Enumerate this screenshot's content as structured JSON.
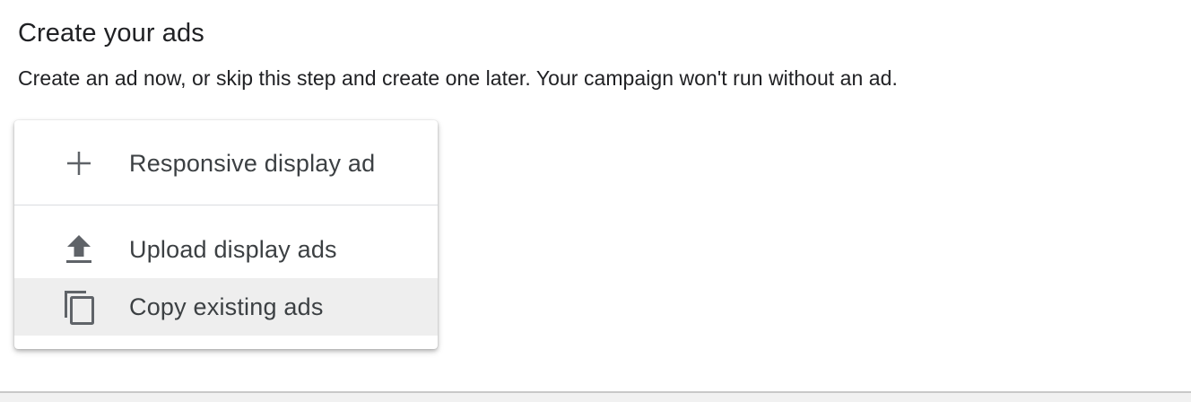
{
  "section": {
    "title": "Create your ads",
    "description": "Create an ad now, or skip this step and create one later. Your campaign won't run without an ad."
  },
  "menu": {
    "items": [
      {
        "label": "Responsive display ad",
        "icon": "plus-icon"
      },
      {
        "label": "Upload display ads",
        "icon": "upload-icon"
      },
      {
        "label": "Copy existing ads",
        "icon": "copy-icon",
        "highlighted": true
      }
    ]
  },
  "colors": {
    "text_primary": "#202124",
    "menu_text": "#3c4043",
    "icon": "#5f6368",
    "divider": "#dadce0",
    "highlight": "#eeeeee"
  }
}
